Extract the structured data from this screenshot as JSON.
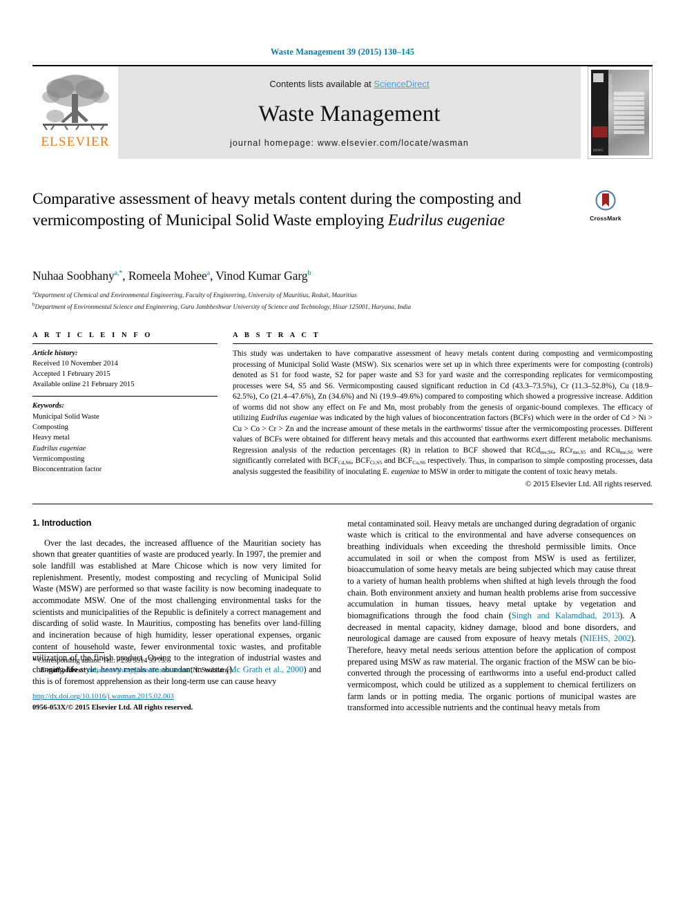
{
  "running_head": "Waste Management 39 (2015) 130–145",
  "masthead": {
    "publisher": "ELSEVIER",
    "contents_prefix": "Contents lists available at ",
    "contents_link": "ScienceDirect",
    "journal_title": "Waste Management",
    "homepage": "journal homepage: www.elsevier.com/locate/wasman",
    "cover_vertical_text": "Waste Management",
    "cover_bars": [
      "GENERATION",
      "SOLID WASTE",
      "TECHNOLOGY AND",
      "RECYCLING",
      "COLLECTION",
      "TREATMENT",
      "DISPOSAL",
      "BIO-DRYING",
      "POLICY"
    ]
  },
  "article": {
    "title_part1": "Comparative assessment of heavy metals content during the composting and vermicomposting of Municipal Solid Waste employing ",
    "title_italic": "Eudrilus eugeniae",
    "crossmark_label": "CrossMark",
    "authors": "Nuhaa Soobhany, Romeela Mohee, Vinod Kumar Garg",
    "affiliation_a": "Department of Chemical and Environmental Engineering, Faculty of Engineering, University of Mauritius, Reduit, Mauritius",
    "affiliation_b": "Department of Environmental Science and Engineering, Guru Jambheshwar University of Science and Technology, Hisar 125001, Haryana, India"
  },
  "info": {
    "heading": "A R T I C L E   I N F O",
    "history_label": "Article history:",
    "history": [
      "Received 10 November 2014",
      "Accepted 1 February 2015",
      "Available online 21 February 2015"
    ],
    "keywords_label": "Keywords:",
    "keywords": [
      "Municipal Solid Waste",
      "Composting",
      "Heavy metal",
      "Eudrilus eugeniae",
      "Vermicomposting",
      "Bioconcentration factor"
    ]
  },
  "abstract": {
    "heading": "A B S T R A C T",
    "text_1": "This study was undertaken to have comparative assessment of heavy metals content during composting and vermicomposting processing of Municipal Solid Waste (MSW). Six scenarios were set up in which three experiments were for composting (controls) denoted as S1 for food waste, S2 for paper waste and S3 for yard waste and the corresponding replicates for vermicomposting processes were S4, S5 and S6. Vermicomposting caused significant reduction in Cd (43.3–73.5%), Cr (11.3–52.8%), Cu (18.9–62.5%), Co (21.4–47.6%), Zn (34.6%) and Ni (19.9–49.6%) compared to composting which showed a progressive increase. Addition of worms did not show any effect on Fe and Mn, most probably from the genesis of organic-bound complexes. The efficacy of utilizing ",
    "italic_1": "Eudrilus eugeniae",
    "text_2": " was indicated by the high values of bioconcentration factors (BCFs) which were in the order of Cd > Ni > Cu > Co > Cr > Zn and the increase amount of these metals in the earthworms' tissue after the vermicomposting processes. Different values of BCFs were obtained for different heavy metals and this accounted that earthworms exert different metabolic mechanisms. Regression analysis of the reduction percentages (R) in relation to BCF showed that RCd",
    "sub_1": "me,S6",
    "text_3": ", RCr",
    "sub_2": "me,S5",
    "text_4": " and RCu",
    "sub_3": "me,S6",
    "text_5": " were significantly correlated with BCF",
    "sub_4": "Cd,S6",
    "text_6": ", BCF",
    "sub_5": "Cr,S5",
    "text_7": " and BCF",
    "sub_6": "Cu,S6",
    "text_8": " respectively. Thus, in comparison to simple composting processes, data analysis suggested the feasibility of inoculating E. ",
    "italic_2": "eugeniae",
    "text_9": " to MSW in order to mitigate the content of toxic heavy metals.",
    "copyright": "© 2015 Elsevier Ltd. All rights reserved."
  },
  "introduction": {
    "heading": "1. Introduction",
    "left_text_a": "Over the last decades, the increased affluence of the Mauritian society has shown that greater quantities of waste are produced yearly. In 1997, the premier and sole landfill was established at Mare Chicose which is now very limited for replenishment. Presently, modest composting and recycling of Municipal Solid Waste (MSW) are performed so that waste facility is now becoming inadequate to accommodate MSW. One of the most challenging environmental tasks for the scientists and municipalities of the Republic is definitely a correct management and discarding of solid waste. In Mauritius, composting has benefits over land-filling and incineration because of high humidity, lesser operational expenses, organic content of household waste, fewer environmental toxic wastes, and profitable utilization of the finish product. Owing to the integration of industrial wastes and changing life style, heavy metals are abundant in waste (",
    "left_cite_1": "Mc Grath et al., 2000",
    "left_text_b": ") and this is of foremost apprehension as their long-term use can cause heavy",
    "right_text_a": "metal contaminated soil. Heavy metals are unchanged during degradation of organic waste which is critical to the environmental and have adverse consequences on breathing individuals when exceeding the threshold permissible limits. Once accumulated in soil or when the compost from MSW is used as fertilizer, bioaccumulation of some heavy metals are being subjected which may cause threat to a variety of human health problems when shifted at high levels through the food chain. Both environment anxiety and human health problems arise from successive accumulation in human tissues, heavy metal uptake by vegetation and biomagnifications through the food chain (",
    "right_cite_1": "Singh and Kalamdhad, 2013",
    "right_text_b": "). A decreased in mental capacity, kidney damage, blood and bone disorders, and neurological damage are caused from exposure of heavy metals (",
    "right_cite_2": "NIEHS, 2002",
    "right_text_c": "). Therefore, heavy metal needs serious attention before the application of compost prepared using MSW as raw material. The organic fraction of the MSW can be bio-converted through the processing of earthworms into a useful end-product called vermicompost, which could be utilized as a supplement to chemical fertilizers on farm lands or in potting media. The organic portions of municipal wastes are transformed into accessible nutrients and the continual heavy metals from"
  },
  "footer": {
    "corresponding_star": "*",
    "corresponding": "Corresponding author. Tel.: +230 5914 59 75.",
    "email_label": "E-mail address:",
    "email": "nuhaa.soobhany@umail.uom.ac.mu",
    "email_suffix": "(N. Soobhany).",
    "doi": "http://dx.doi.org/10.1016/j.wasman.2015.02.003",
    "issn": "0956-053X/",
    "issn_rights": "© 2015 Elsevier Ltd. All rights reserved."
  },
  "colors": {
    "link_blue": "#0b7aa8",
    "sciencedirect_blue": "#3aa6d8",
    "elsevier_orange": "#e87b1e",
    "crossmark_red": "#a32020"
  }
}
